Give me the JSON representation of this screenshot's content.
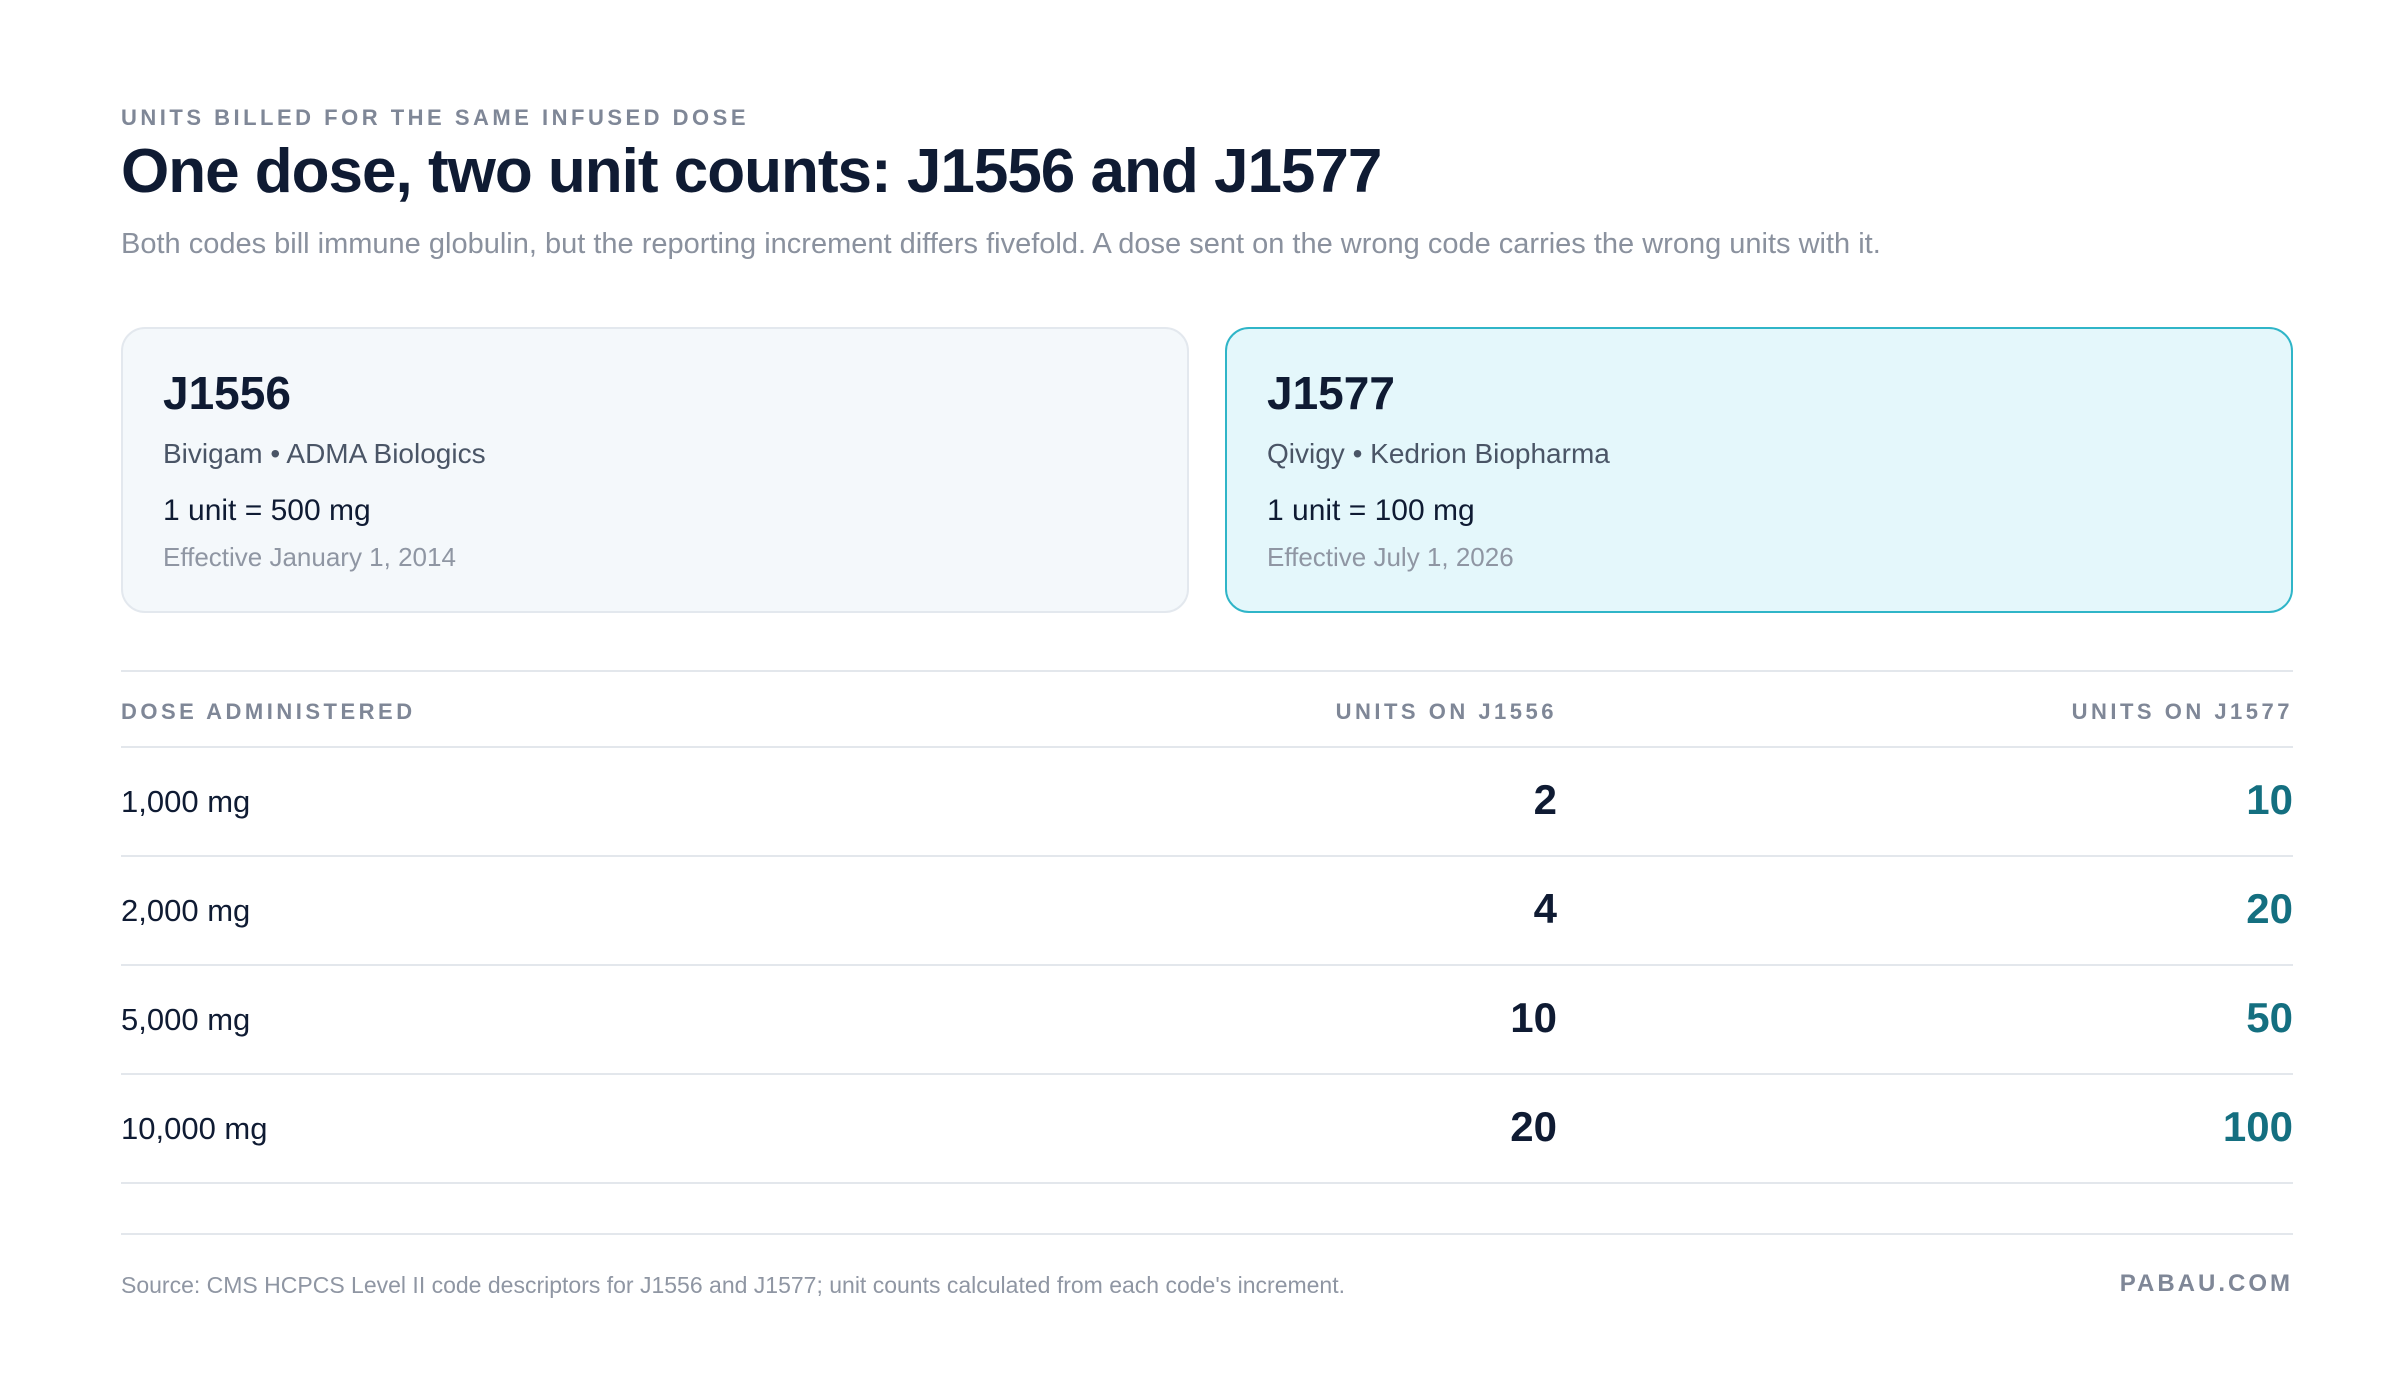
{
  "header": {
    "eyebrow": "UNITS BILLED FOR THE SAME INFUSED DOSE",
    "title": "One dose, two unit counts: J1556 and J1577",
    "subtitle": "Both codes bill immune globulin, but the reporting increment differs fivefold. A dose sent on the wrong code carries the wrong units with it."
  },
  "cards": [
    {
      "code": "J1556",
      "drug": "Bivigam • ADMA Biologics",
      "unit": "1 unit = 500 mg",
      "effective": "Effective January 1, 2014"
    },
    {
      "code": "J1577",
      "drug": "Qivigy • Kedrion Biopharma",
      "unit": "1 unit = 100 mg",
      "effective": "Effective July 1, 2026"
    }
  ],
  "table": {
    "headers": {
      "dose": "DOSE ADMINISTERED",
      "a": "UNITS ON J1556",
      "b": "UNITS ON J1577"
    },
    "rows": [
      {
        "dose": "1,000 mg",
        "a": "2",
        "b": "10"
      },
      {
        "dose": "2,000 mg",
        "a": "4",
        "b": "20"
      },
      {
        "dose": "5,000 mg",
        "a": "10",
        "b": "50"
      },
      {
        "dose": "10,000 mg",
        "a": "20",
        "b": "100"
      }
    ]
  },
  "footer": {
    "source": "Source: CMS HCPCS Level II code descriptors for J1556 and J1577; unit counts calculated from each code's increment.",
    "brand": "PABAU.COM"
  },
  "colors": {
    "accent": "#146f80",
    "accent_border": "#2fb5c8",
    "card_b_bg": "#e4f7fb",
    "card_a_bg": "#f4f8fb",
    "text_primary": "#0f1b33",
    "text_muted": "#8a919e"
  }
}
